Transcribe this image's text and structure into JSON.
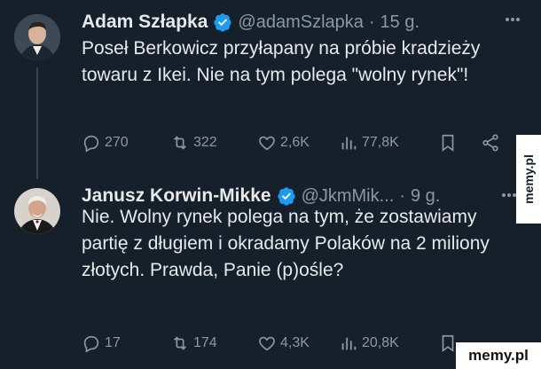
{
  "tweets": [
    {
      "name": "Adam Szłapka",
      "handle": "@adamSzlapka",
      "dot": "·",
      "time": "15 g.",
      "text": "Poseł Berkowicz przyłapany na próbie kradzieży towaru z Ikei. Nie na tym polega \"wolny rynek\"!",
      "replies": "270",
      "retweets": "322",
      "likes": "2,6K",
      "views": "77,8K"
    },
    {
      "name": "Janusz Korwin-Mikke",
      "handle": "@JkmMik...",
      "dot": "·",
      "time": "9 g.",
      "text": "Nie. Wolny rynek polega na tym, że zostawiamy partię z długiem i okradamy Polaków na 2 miliony złotych. Prawda, Panie (p)ośle?",
      "replies": "17",
      "retweets": "174",
      "likes": "4,3K",
      "views": "20,8K"
    }
  ],
  "watermark": {
    "side": "memy.pl",
    "corner": "memy.pl"
  },
  "colors": {
    "background": "#15202b",
    "text": "#e7e9ea",
    "muted": "#8b98a5",
    "verified": "#1d9bf0"
  }
}
